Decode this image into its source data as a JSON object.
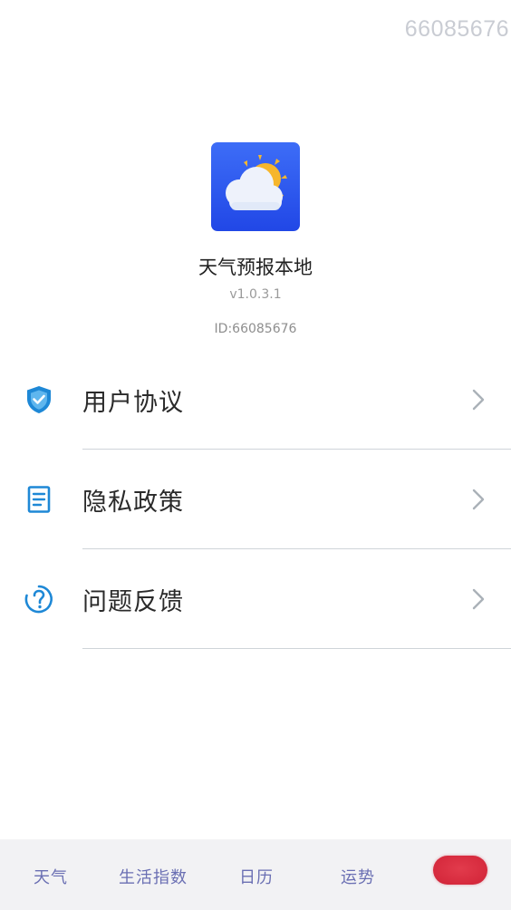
{
  "watermark": "66085676",
  "app": {
    "icon": "weather-cloud-sun-icon",
    "name": "天气预报本地",
    "version": "v1.0.3.1",
    "id": "ID:66085676"
  },
  "menu": {
    "items": [
      {
        "label": "用户协议",
        "icon": "shield-check-icon"
      },
      {
        "label": "隐私政策",
        "icon": "document-icon"
      },
      {
        "label": "问题反馈",
        "icon": "question-circle-icon"
      }
    ]
  },
  "tabbar": {
    "tabs": [
      {
        "label": "天气"
      },
      {
        "label": "生活指数"
      },
      {
        "label": "日历"
      },
      {
        "label": "运势"
      }
    ]
  },
  "colors": {
    "accent": "#1e88d6",
    "tab_text": "#6a6fb3",
    "icon_bg": "#2d55ee",
    "badge": "#d62a3d"
  }
}
